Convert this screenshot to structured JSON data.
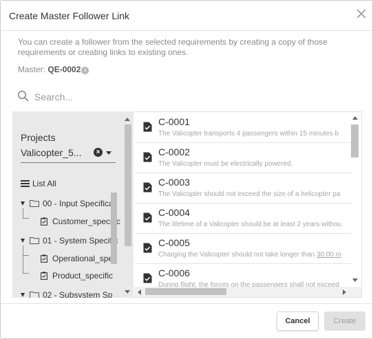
{
  "dialog": {
    "title": "Create Master Follower Link",
    "description": "You can create a follower from the selected requirements by creating a copy of those requirements or creating links to existing ones.",
    "master_label": "Master:",
    "master_value": "QE-0002"
  },
  "search": {
    "placeholder": "Search..."
  },
  "projects": {
    "label": "Projects",
    "selected": "Valicopter_5..."
  },
  "tree": {
    "list_all": "List All",
    "items": [
      {
        "label": "00 - Input Specifica",
        "type": "folder"
      },
      {
        "label": "Customer_specific",
        "type": "file"
      },
      {
        "label": "01 - System Specific",
        "type": "folder"
      },
      {
        "label": "Operational_spe",
        "type": "file"
      },
      {
        "label": "Product_specific",
        "type": "file"
      },
      {
        "label": "02 - Subsystem Sp",
        "type": "folder"
      }
    ]
  },
  "requirements": [
    {
      "id": "C-0001",
      "desc": "The Valicopter transports 4 passengers within 15 minutes b"
    },
    {
      "id": "C-0002",
      "desc": "The Valicopter must be electrically powered."
    },
    {
      "id": "C-0003",
      "desc": "The Valicopter should not exceed the size of a helicopter pa"
    },
    {
      "id": "C-0004",
      "desc": "The lifetime of a Valicopter should be at least 2 years withou"
    },
    {
      "id": "C-0005",
      "desc": "Charging the Valicopter should not take longer than",
      "desc_underlined": "30.00 m"
    },
    {
      "id": "C-0006",
      "desc": "During flight, the forces on the passengers shall not exceed"
    }
  ],
  "footer": {
    "cancel": "Cancel",
    "create": "Create"
  },
  "icons": {
    "close": "close-icon",
    "search": "search-icon",
    "info": "info-icon",
    "clear": "clear-selection-icon",
    "dropdown": "chevron-down-icon",
    "list": "list-icon",
    "folder": "folder-icon",
    "document": "clipboard-icon",
    "requirement": "document-check-icon"
  },
  "colors": {
    "panel_bg": "#e9e9e9",
    "text": "#333333",
    "muted": "#8a8a8a",
    "disabled_bg": "#e1e1e1"
  }
}
